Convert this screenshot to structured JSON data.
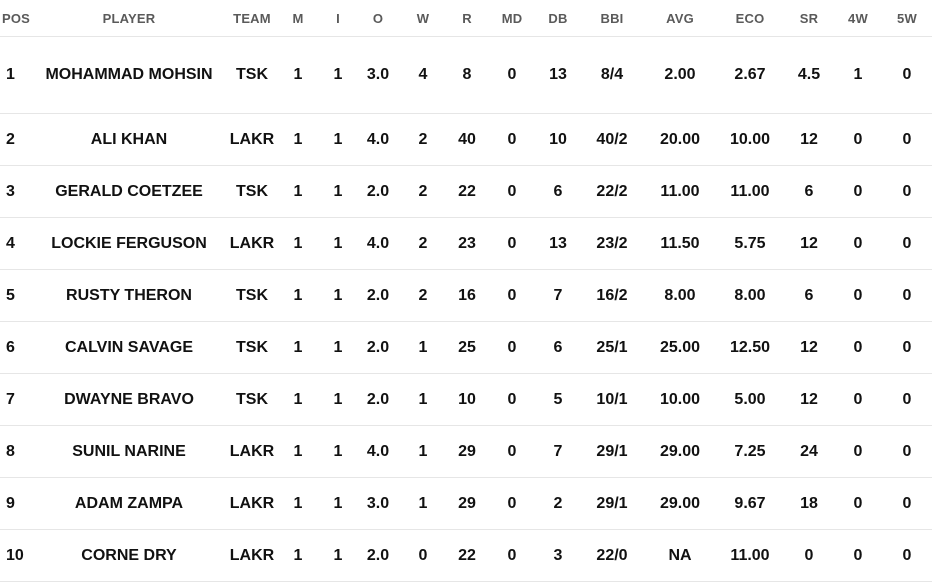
{
  "columns": [
    "POS",
    "PLAYER",
    "TEAM",
    "M",
    "I",
    "O",
    "W",
    "R",
    "MD",
    "DB",
    "BBI",
    "AVG",
    "ECO",
    "SR",
    "4W",
    "5W"
  ],
  "rows": [
    [
      "1",
      "MOHAMMAD MOHSIN",
      "TSK",
      "1",
      "1",
      "3.0",
      "4",
      "8",
      "0",
      "13",
      "8/4",
      "2.00",
      "2.67",
      "4.5",
      "1",
      "0"
    ],
    [
      "2",
      "ALI KHAN",
      "LAKR",
      "1",
      "1",
      "4.0",
      "2",
      "40",
      "0",
      "10",
      "40/2",
      "20.00",
      "10.00",
      "12",
      "0",
      "0"
    ],
    [
      "3",
      "GERALD COETZEE",
      "TSK",
      "1",
      "1",
      "2.0",
      "2",
      "22",
      "0",
      "6",
      "22/2",
      "11.00",
      "11.00",
      "6",
      "0",
      "0"
    ],
    [
      "4",
      "LOCKIE FERGUSON",
      "LAKR",
      "1",
      "1",
      "4.0",
      "2",
      "23",
      "0",
      "13",
      "23/2",
      "11.50",
      "5.75",
      "12",
      "0",
      "0"
    ],
    [
      "5",
      "RUSTY THERON",
      "TSK",
      "1",
      "1",
      "2.0",
      "2",
      "16",
      "0",
      "7",
      "16/2",
      "8.00",
      "8.00",
      "6",
      "0",
      "0"
    ],
    [
      "6",
      "CALVIN SAVAGE",
      "TSK",
      "1",
      "1",
      "2.0",
      "1",
      "25",
      "0",
      "6",
      "25/1",
      "25.00",
      "12.50",
      "12",
      "0",
      "0"
    ],
    [
      "7",
      "DWAYNE BRAVO",
      "TSK",
      "1",
      "1",
      "2.0",
      "1",
      "10",
      "0",
      "5",
      "10/1",
      "10.00",
      "5.00",
      "12",
      "0",
      "0"
    ],
    [
      "8",
      "SUNIL NARINE",
      "LAKR",
      "1",
      "1",
      "4.0",
      "1",
      "29",
      "0",
      "7",
      "29/1",
      "29.00",
      "7.25",
      "24",
      "0",
      "0"
    ],
    [
      "9",
      "ADAM ZAMPA",
      "LAKR",
      "1",
      "1",
      "3.0",
      "1",
      "29",
      "0",
      "2",
      "29/1",
      "29.00",
      "9.67",
      "18",
      "0",
      "0"
    ],
    [
      "10",
      "CORNE DRY",
      "LAKR",
      "1",
      "1",
      "2.0",
      "0",
      "22",
      "0",
      "3",
      "22/0",
      "NA",
      "11.00",
      "0",
      "0",
      "0"
    ]
  ]
}
